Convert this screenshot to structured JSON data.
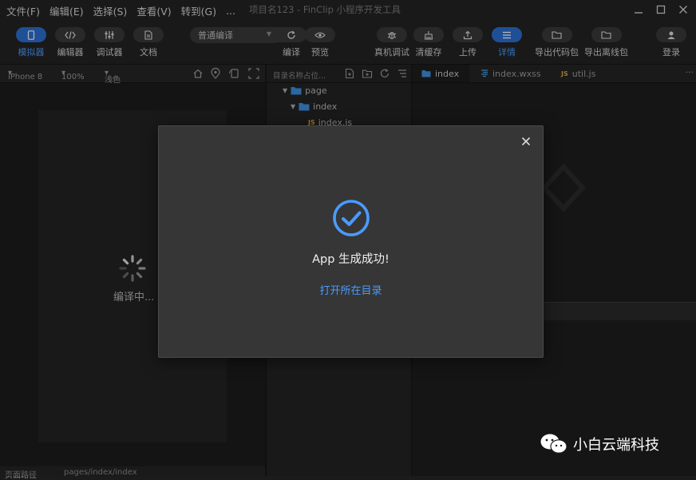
{
  "menu": [
    "文件(F)",
    "编辑(E)",
    "选择(S)",
    "查看(V)",
    "转到(G)",
    "..."
  ],
  "window_title": "项目名123 - FinClip 小程序开发工具",
  "toolbar": {
    "simulator": "模拟器",
    "editor": "编辑器",
    "debugger": "调试器",
    "docs": "文档",
    "compile_mode": "普通编译",
    "compile": "编译",
    "preview": "预览",
    "device_debug": "真机调试",
    "clear_cache": "清缓存",
    "upload": "上传",
    "details": "详情",
    "export_code": "导出代码包",
    "export_offline": "导出离线包",
    "login": "登录"
  },
  "simulator": {
    "device": "iPhone 8",
    "zoom": "100%",
    "theme": "浅色",
    "compiling": "编译中...",
    "status_left": "页面路径",
    "status_path": "pages/index/index"
  },
  "explorer": {
    "search_placeholder": "目录名称占位...",
    "tree": [
      {
        "label": "page",
        "kind": "folder"
      },
      {
        "label": "index",
        "kind": "folder"
      },
      {
        "label": "index.js",
        "kind": "js"
      }
    ]
  },
  "editor_tabs": [
    {
      "label": "index",
      "kind": "folder",
      "active": true
    },
    {
      "label": "index.wxss",
      "kind": "css",
      "active": false
    },
    {
      "label": "util.js",
      "kind": "js",
      "active": false
    }
  ],
  "modal": {
    "message": "App 生成成功!",
    "link": "打开所在目录"
  },
  "watermark": "小白云端科技",
  "colors": {
    "accent": "#4a9bff",
    "active_button": "#2b6fd1",
    "folder": "#3d8fe0",
    "js_badge": "#d9a43a"
  }
}
